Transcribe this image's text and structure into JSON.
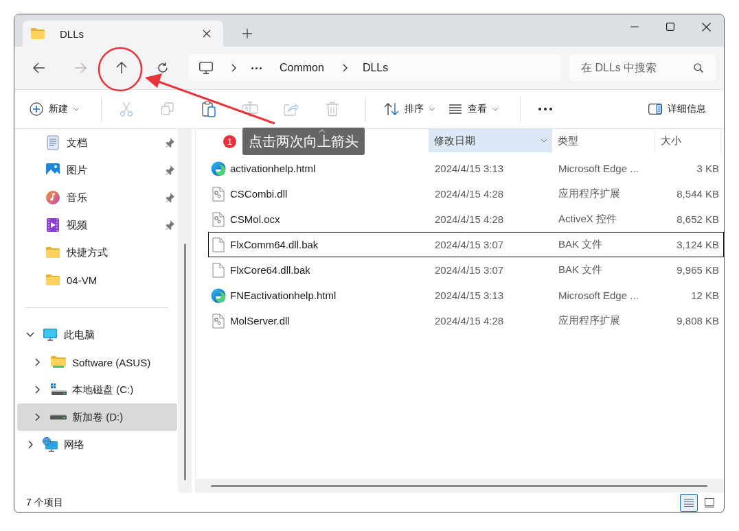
{
  "tab": {
    "title": "DLLs"
  },
  "nav_buttons": [
    {
      "kind": "back",
      "disabled": false
    },
    {
      "kind": "forward",
      "disabled": true
    },
    {
      "kind": "up",
      "disabled": false
    },
    {
      "kind": "refresh",
      "disabled": false
    }
  ],
  "address": {
    "crumbs": [
      "Common",
      "DLLs"
    ]
  },
  "search": {
    "placeholder": "在 DLLs 中搜索"
  },
  "commands": [
    {
      "kind": "new",
      "label": "新建"
    },
    {
      "kind": "cut",
      "disabled": true
    },
    {
      "kind": "copy",
      "disabled": true
    },
    {
      "kind": "paste",
      "disabled": false
    },
    {
      "kind": "rename",
      "disabled": true
    },
    {
      "kind": "share",
      "disabled": true
    },
    {
      "kind": "delete",
      "disabled": true
    },
    {
      "kind": "sort",
      "label": "排序"
    },
    {
      "kind": "view",
      "label": "查看"
    },
    {
      "kind": "more"
    }
  ],
  "details_button": {
    "label": "详细信息"
  },
  "sidebar": {
    "quick_access": [
      {
        "label": "文档",
        "kind": "documents",
        "pinned": true
      },
      {
        "label": "图片",
        "kind": "pictures",
        "pinned": true
      },
      {
        "label": "音乐",
        "kind": "music",
        "pinned": true
      },
      {
        "label": "视频",
        "kind": "videos",
        "pinned": true
      },
      {
        "label": "快捷方式",
        "kind": "folder",
        "pinned": false
      },
      {
        "label": "04-VM",
        "kind": "folder",
        "pinned": false
      }
    ],
    "tree": [
      {
        "label": "此电脑",
        "kind": "pc",
        "expanded": true,
        "selected": false,
        "children": [
          {
            "label": "Software (ASUS)",
            "kind": "folderdrive",
            "expanded": false,
            "selected": false
          },
          {
            "label": "本地磁盘 (C:)",
            "kind": "systemdrive",
            "expanded": false,
            "selected": false
          },
          {
            "label": "新加卷 (D:)",
            "kind": "drive",
            "expanded": false,
            "selected": true
          }
        ]
      },
      {
        "label": "网络",
        "kind": "network",
        "expanded": false,
        "selected": false
      }
    ]
  },
  "table": {
    "columns": [
      {
        "label": "修改日期",
        "highlighted": true
      },
      {
        "label": "类型",
        "highlighted": false
      },
      {
        "label": "大小",
        "highlighted": false
      }
    ],
    "rows": [
      {
        "name": "activationhelp.html",
        "kind": "edge",
        "date": "2024/4/15 3:13",
        "type": "Microsoft Edge ...",
        "size": "3 KB",
        "focused": false
      },
      {
        "name": "CSCombi.dll",
        "kind": "dll",
        "date": "2024/4/15 4:28",
        "type": "应用程序扩展",
        "size": "8,544 KB",
        "focused": false
      },
      {
        "name": "CSMol.ocx",
        "kind": "dll",
        "date": "2024/4/15 4:28",
        "type": "ActiveX 控件",
        "size": "8,652 KB",
        "focused": false
      },
      {
        "name": "FlxComm64.dll.bak",
        "kind": "file",
        "date": "2024/4/15 3:07",
        "type": "BAK 文件",
        "size": "3,124 KB",
        "focused": true
      },
      {
        "name": "FlxCore64.dll.bak",
        "kind": "file",
        "date": "2024/4/15 3:07",
        "type": "BAK 文件",
        "size": "9,965 KB",
        "focused": false
      },
      {
        "name": "FNEactivationhelp.html",
        "kind": "edge",
        "date": "2024/4/15 3:13",
        "type": "Microsoft Edge ...",
        "size": "12 KB",
        "focused": false
      },
      {
        "name": "MolServer.dll",
        "kind": "dll",
        "date": "2024/4/15 4:28",
        "type": "应用程序扩展",
        "size": "9,808 KB",
        "focused": false
      }
    ]
  },
  "annotation": {
    "badge": "1",
    "text": "点击两次向上箭头"
  },
  "status_bar": {
    "count": "7 个项目",
    "views": [
      {
        "kind": "details",
        "selected": true
      },
      {
        "kind": "preview",
        "selected": false
      }
    ]
  }
}
